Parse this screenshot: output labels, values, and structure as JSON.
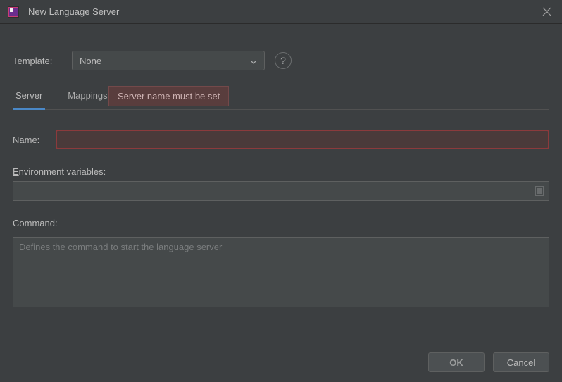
{
  "window": {
    "title": "New Language Server"
  },
  "template": {
    "label": "Template:",
    "value": "None"
  },
  "tabs": {
    "server": "Server",
    "mappings": "Mappings"
  },
  "tooltip": {
    "name_error": "Server name must be set"
  },
  "form": {
    "name_label": "Name:",
    "name_value": "",
    "env_label_prefix": "E",
    "env_label_rest": "nvironment variables:",
    "env_value": "",
    "command_label": "Command:",
    "command_placeholder": "Defines the command to start the language server",
    "command_value": ""
  },
  "buttons": {
    "ok": "OK",
    "cancel": "Cancel"
  }
}
